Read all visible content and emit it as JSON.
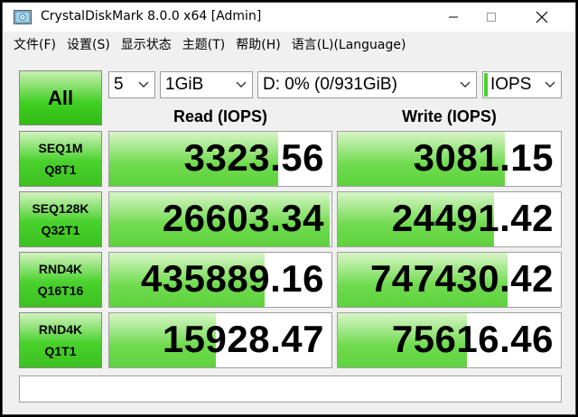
{
  "window": {
    "title": "CrystalDiskMark 8.0.0 x64 [Admin]"
  },
  "menu": [
    "文件(F)",
    "设置(S)",
    "显示状态",
    "主题(T)",
    "帮助(H)",
    "语言(L)(Language)"
  ],
  "controls": {
    "all_label": "All",
    "count": "5",
    "size": "1GiB",
    "drive": "D: 0% (0/931GiB)",
    "unit": "IOPS"
  },
  "headers": {
    "read": "Read (IOPS)",
    "write": "Write (IOPS)"
  },
  "rows": [
    {
      "line1": "SEQ1M",
      "line2": "Q8T1",
      "read": "3323.56",
      "write": "3081.15",
      "read_fill": 0.76,
      "write_fill": 0.75
    },
    {
      "line1": "SEQ128K",
      "line2": "Q32T1",
      "read": "26603.34",
      "write": "24491.42",
      "read_fill": 0.99,
      "write_fill": 0.7
    },
    {
      "line1": "RND4K",
      "line2": "Q16T16",
      "read": "435889.16",
      "write": "747430.42",
      "read_fill": 0.7,
      "write_fill": 0.76
    },
    {
      "line1": "RND4K",
      "line2": "Q1T1",
      "read": "15928.47",
      "write": "75616.46",
      "read_fill": 0.48,
      "write_fill": 0.58
    }
  ],
  "status": "",
  "colors": {
    "accent_green": "#3fcf22",
    "bar_green": "#6fdb4e"
  }
}
